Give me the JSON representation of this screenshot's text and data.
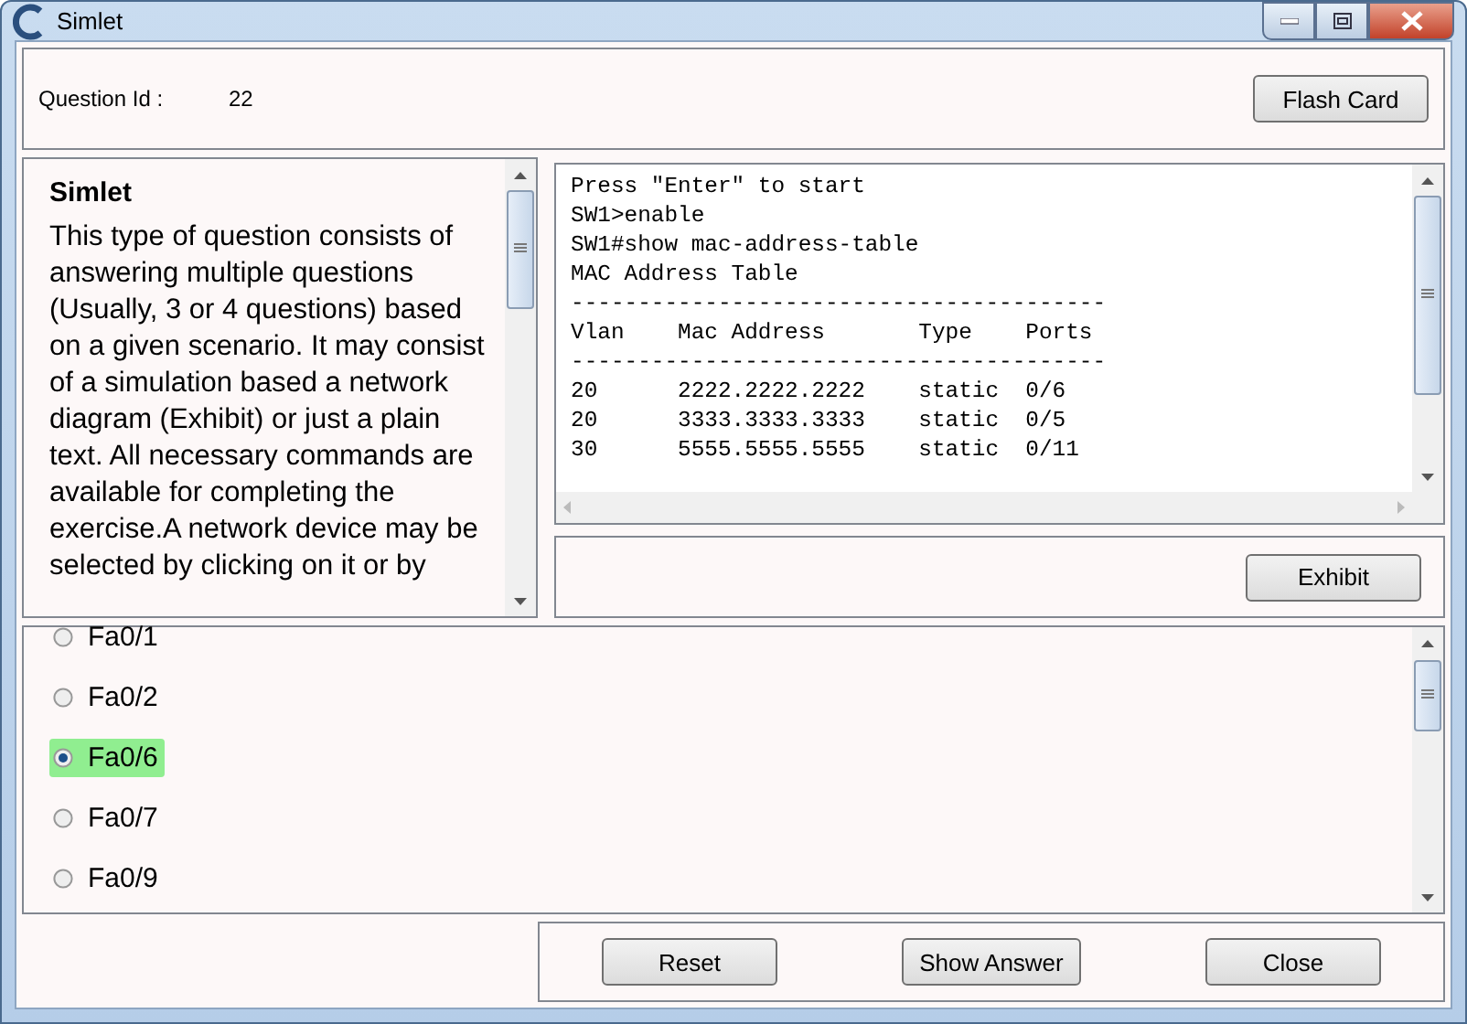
{
  "window": {
    "title": "Simlet"
  },
  "header": {
    "label": "Question Id :",
    "value": "22",
    "button": "Flash Card"
  },
  "description": {
    "title": "Simlet",
    "text": "This type of question consists of answering multiple questions (Usually, 3 or 4 questions) based on a given scenario. It may consist of a simulation based a network diagram (Exhibit) or just a plain text.  All necessary commands are available for completing the exercise.A network device may be selected by clicking on it or by"
  },
  "terminal": {
    "lines": [
      "Press \"Enter\" to start",
      "SW1>enable",
      "SW1#show mac-address-table",
      "MAC Address Table",
      "----------------------------------------",
      "Vlan    Mac Address       Type    Ports",
      "----------------------------------------",
      "20      2222.2222.2222    static  0/6",
      "20      3333.3333.3333    static  0/5",
      "30      5555.5555.5555    static  0/11"
    ]
  },
  "exhibit_button": "Exhibit",
  "options": [
    {
      "label": "Fa0/1",
      "selected": false
    },
    {
      "label": "Fa0/2",
      "selected": false
    },
    {
      "label": "Fa0/6",
      "selected": true
    },
    {
      "label": "Fa0/7",
      "selected": false
    },
    {
      "label": "Fa0/9",
      "selected": false
    }
  ],
  "buttons": [
    "Reset",
    "Show Answer",
    "Close"
  ]
}
